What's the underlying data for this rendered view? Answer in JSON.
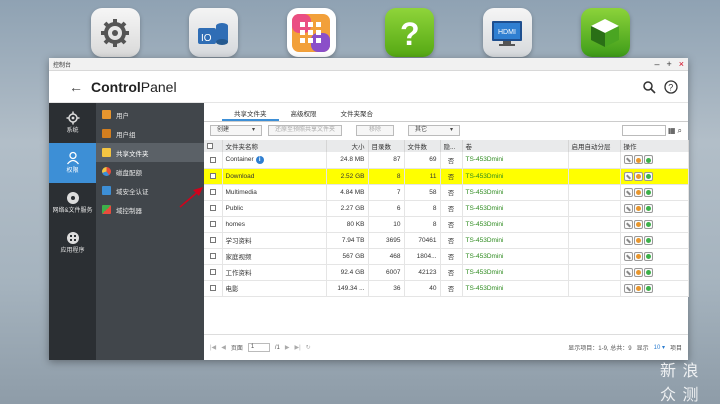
{
  "window": {
    "title": "控制台"
  },
  "header": {
    "title_bold": "Control",
    "title_rest": "Panel"
  },
  "nav_primary": [
    {
      "label": "系统",
      "icon": "gear-icon"
    },
    {
      "label": "权限",
      "icon": "user-icon"
    },
    {
      "label": "网络&文件服务",
      "icon": "network-icon"
    },
    {
      "label": "应用程序",
      "icon": "apps-icon"
    }
  ],
  "nav_secondary": [
    {
      "label": "用户",
      "icon": "user-icon",
      "color": "#e8962e"
    },
    {
      "label": "用户组",
      "icon": "users-icon",
      "color": "#e8962e"
    },
    {
      "label": "共享文件夹",
      "icon": "folder-icon",
      "color": "#f4c542"
    },
    {
      "label": "磁盘配额",
      "icon": "pie-icon",
      "color": "#e84c3d"
    },
    {
      "label": "域安全认证",
      "icon": "shield-icon",
      "color": "#3d8fd6"
    },
    {
      "label": "域控制器",
      "icon": "domain-icon",
      "color": "#3db04a"
    }
  ],
  "tabs": [
    "共享文件夹",
    "高级权限",
    "文件夹聚合"
  ],
  "toolbar": {
    "create": "创建",
    "remove_snapshot": "还原至预照共享文件夹",
    "delete": "移除",
    "other": "其它"
  },
  "table": {
    "headers": [
      "文件夹名称",
      "大小",
      "目录数",
      "文件数",
      "隐...",
      "卷",
      "启用自动分层",
      "操作"
    ],
    "rows": [
      {
        "name": "Container",
        "size": "24.8 MB",
        "dirs": "87",
        "files": "69",
        "hidden": "否",
        "volume": "TS-453Dmini",
        "info": true,
        "highlight": false
      },
      {
        "name": "Download",
        "size": "2.52 GB",
        "dirs": "8",
        "files": "11",
        "hidden": "否",
        "volume": "TS-453Dmini",
        "info": false,
        "highlight": true
      },
      {
        "name": "Multimedia",
        "size": "4.84 MB",
        "dirs": "7",
        "files": "58",
        "hidden": "否",
        "volume": "TS-453Dmini",
        "info": false,
        "highlight": false
      },
      {
        "name": "Public",
        "size": "2.27 GB",
        "dirs": "6",
        "files": "8",
        "hidden": "否",
        "volume": "TS-453Dmini",
        "info": false,
        "highlight": false
      },
      {
        "name": "homes",
        "size": "80 KB",
        "dirs": "10",
        "files": "8",
        "hidden": "否",
        "volume": "TS-453Dmini",
        "info": false,
        "highlight": false
      },
      {
        "name": "学习资料",
        "size": "7.94 TB",
        "dirs": "3695",
        "files": "70461",
        "hidden": "否",
        "volume": "TS-453Dmini",
        "info": false,
        "highlight": false
      },
      {
        "name": "家庭视频",
        "size": "567 GB",
        "dirs": "468",
        "files": "1804...",
        "hidden": "否",
        "volume": "TS-453Dmini",
        "info": false,
        "highlight": false
      },
      {
        "name": "工作资料",
        "size": "92.4 GB",
        "dirs": "6007",
        "files": "42123",
        "hidden": "否",
        "volume": "TS-453Dmini",
        "info": false,
        "highlight": false
      },
      {
        "name": "电影",
        "size": "149.34 ...",
        "dirs": "36",
        "files": "40",
        "hidden": "否",
        "volume": "TS-453Dmini",
        "info": false,
        "highlight": false
      }
    ]
  },
  "footer": {
    "page_label": "页面",
    "page_value": "1",
    "page_total": "/1",
    "display_items": "显示项目：1-9, 总共：9",
    "show": "显示",
    "per_page": "10",
    "items": "项目"
  },
  "watermark": "新 浪 众 测",
  "colors": {
    "accent": "#3d8fd6",
    "highlight": "#ffff00",
    "volume": "#2e8b1f"
  }
}
